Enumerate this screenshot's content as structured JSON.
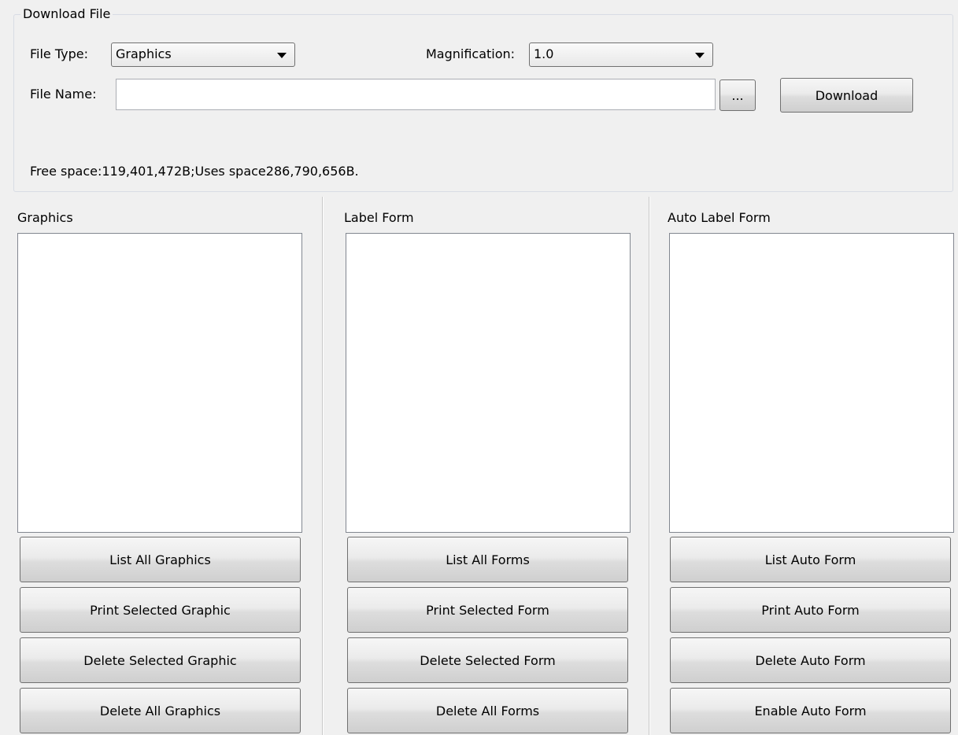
{
  "download": {
    "group_title": "Download File",
    "file_type_label": "File Type:",
    "file_type_value": "Graphics",
    "magnification_label": "Magnification:",
    "magnification_value": "1.0",
    "file_name_label": "File Name:",
    "file_name_value": "",
    "browse_label": "...",
    "download_label": "Download",
    "free_space_text": "Free space:119,401,472B;Uses space286,790,656B."
  },
  "graphics": {
    "title": "Graphics",
    "buttons": [
      "List All Graphics",
      "Print Selected Graphic",
      "Delete Selected Graphic",
      "Delete All Graphics"
    ]
  },
  "label_form": {
    "title": "Label Form",
    "buttons": [
      "List All Forms",
      "Print Selected Form",
      "Delete Selected Form",
      "Delete All Forms"
    ]
  },
  "auto_label_form": {
    "title": "Auto Label Form",
    "buttons": [
      "List Auto Form",
      "Print Auto Form",
      "Delete Auto Form",
      "Enable Auto Form"
    ]
  }
}
